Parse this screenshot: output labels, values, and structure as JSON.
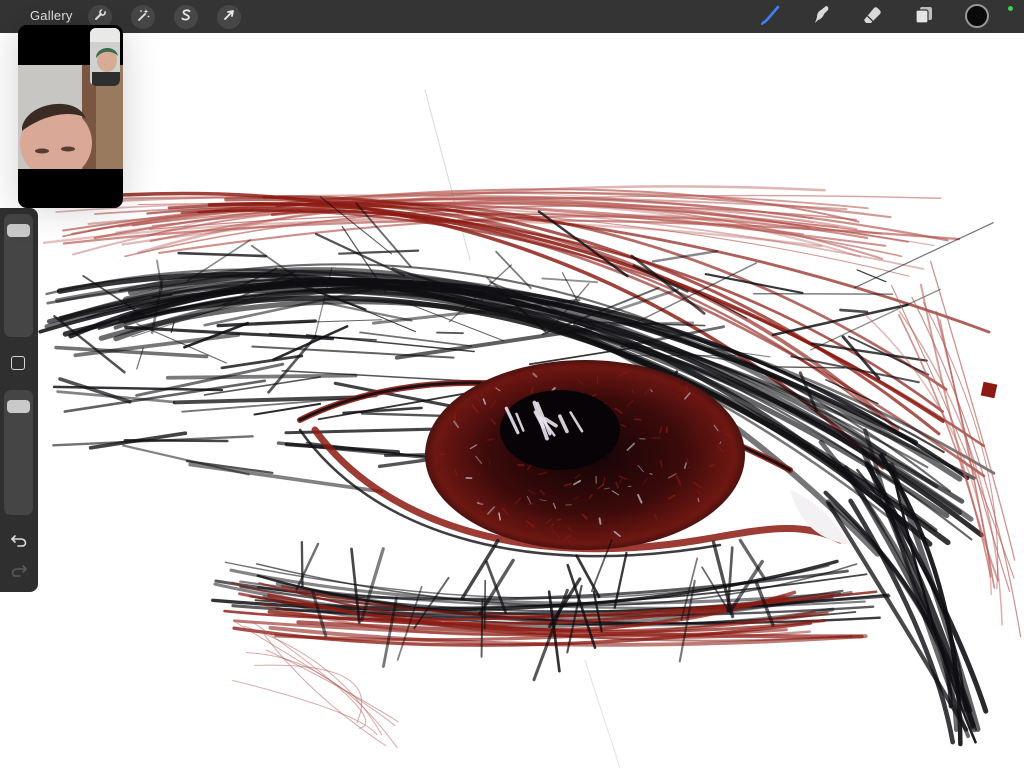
{
  "toolbar": {
    "gallery_label": "Gallery",
    "left_tools": [
      {
        "name": "actions",
        "icon": "wrench-icon"
      },
      {
        "name": "adjustments",
        "icon": "magic-wand-icon"
      },
      {
        "name": "selection",
        "icon": "selection-s-icon"
      },
      {
        "name": "transform",
        "icon": "arrow-cursor-icon"
      }
    ],
    "right_tools": [
      {
        "name": "brush",
        "icon": "brush-icon",
        "active": true
      },
      {
        "name": "smudge",
        "icon": "smudge-icon",
        "active": false
      },
      {
        "name": "eraser",
        "icon": "eraser-icon",
        "active": false
      },
      {
        "name": "layers",
        "icon": "layers-icon",
        "active": false
      }
    ],
    "active_color": "#0a0a0a",
    "active_tool_color": "#3b82f6",
    "status_dot_color": "#39d353"
  },
  "sidebar": {
    "brush_size": 0.95,
    "brush_opacity": 0.95,
    "modify_icon": "square-outline-icon",
    "undo_icon": "undo-icon",
    "redo_icon": "redo-icon",
    "redo_enabled": false
  },
  "pip": {
    "description_icon": "video-call-icon"
  },
  "canvas": {
    "ink_colors": {
      "black": "#0e0e12",
      "red": "#8b1a12",
      "light_red": "#b4554f"
    }
  }
}
